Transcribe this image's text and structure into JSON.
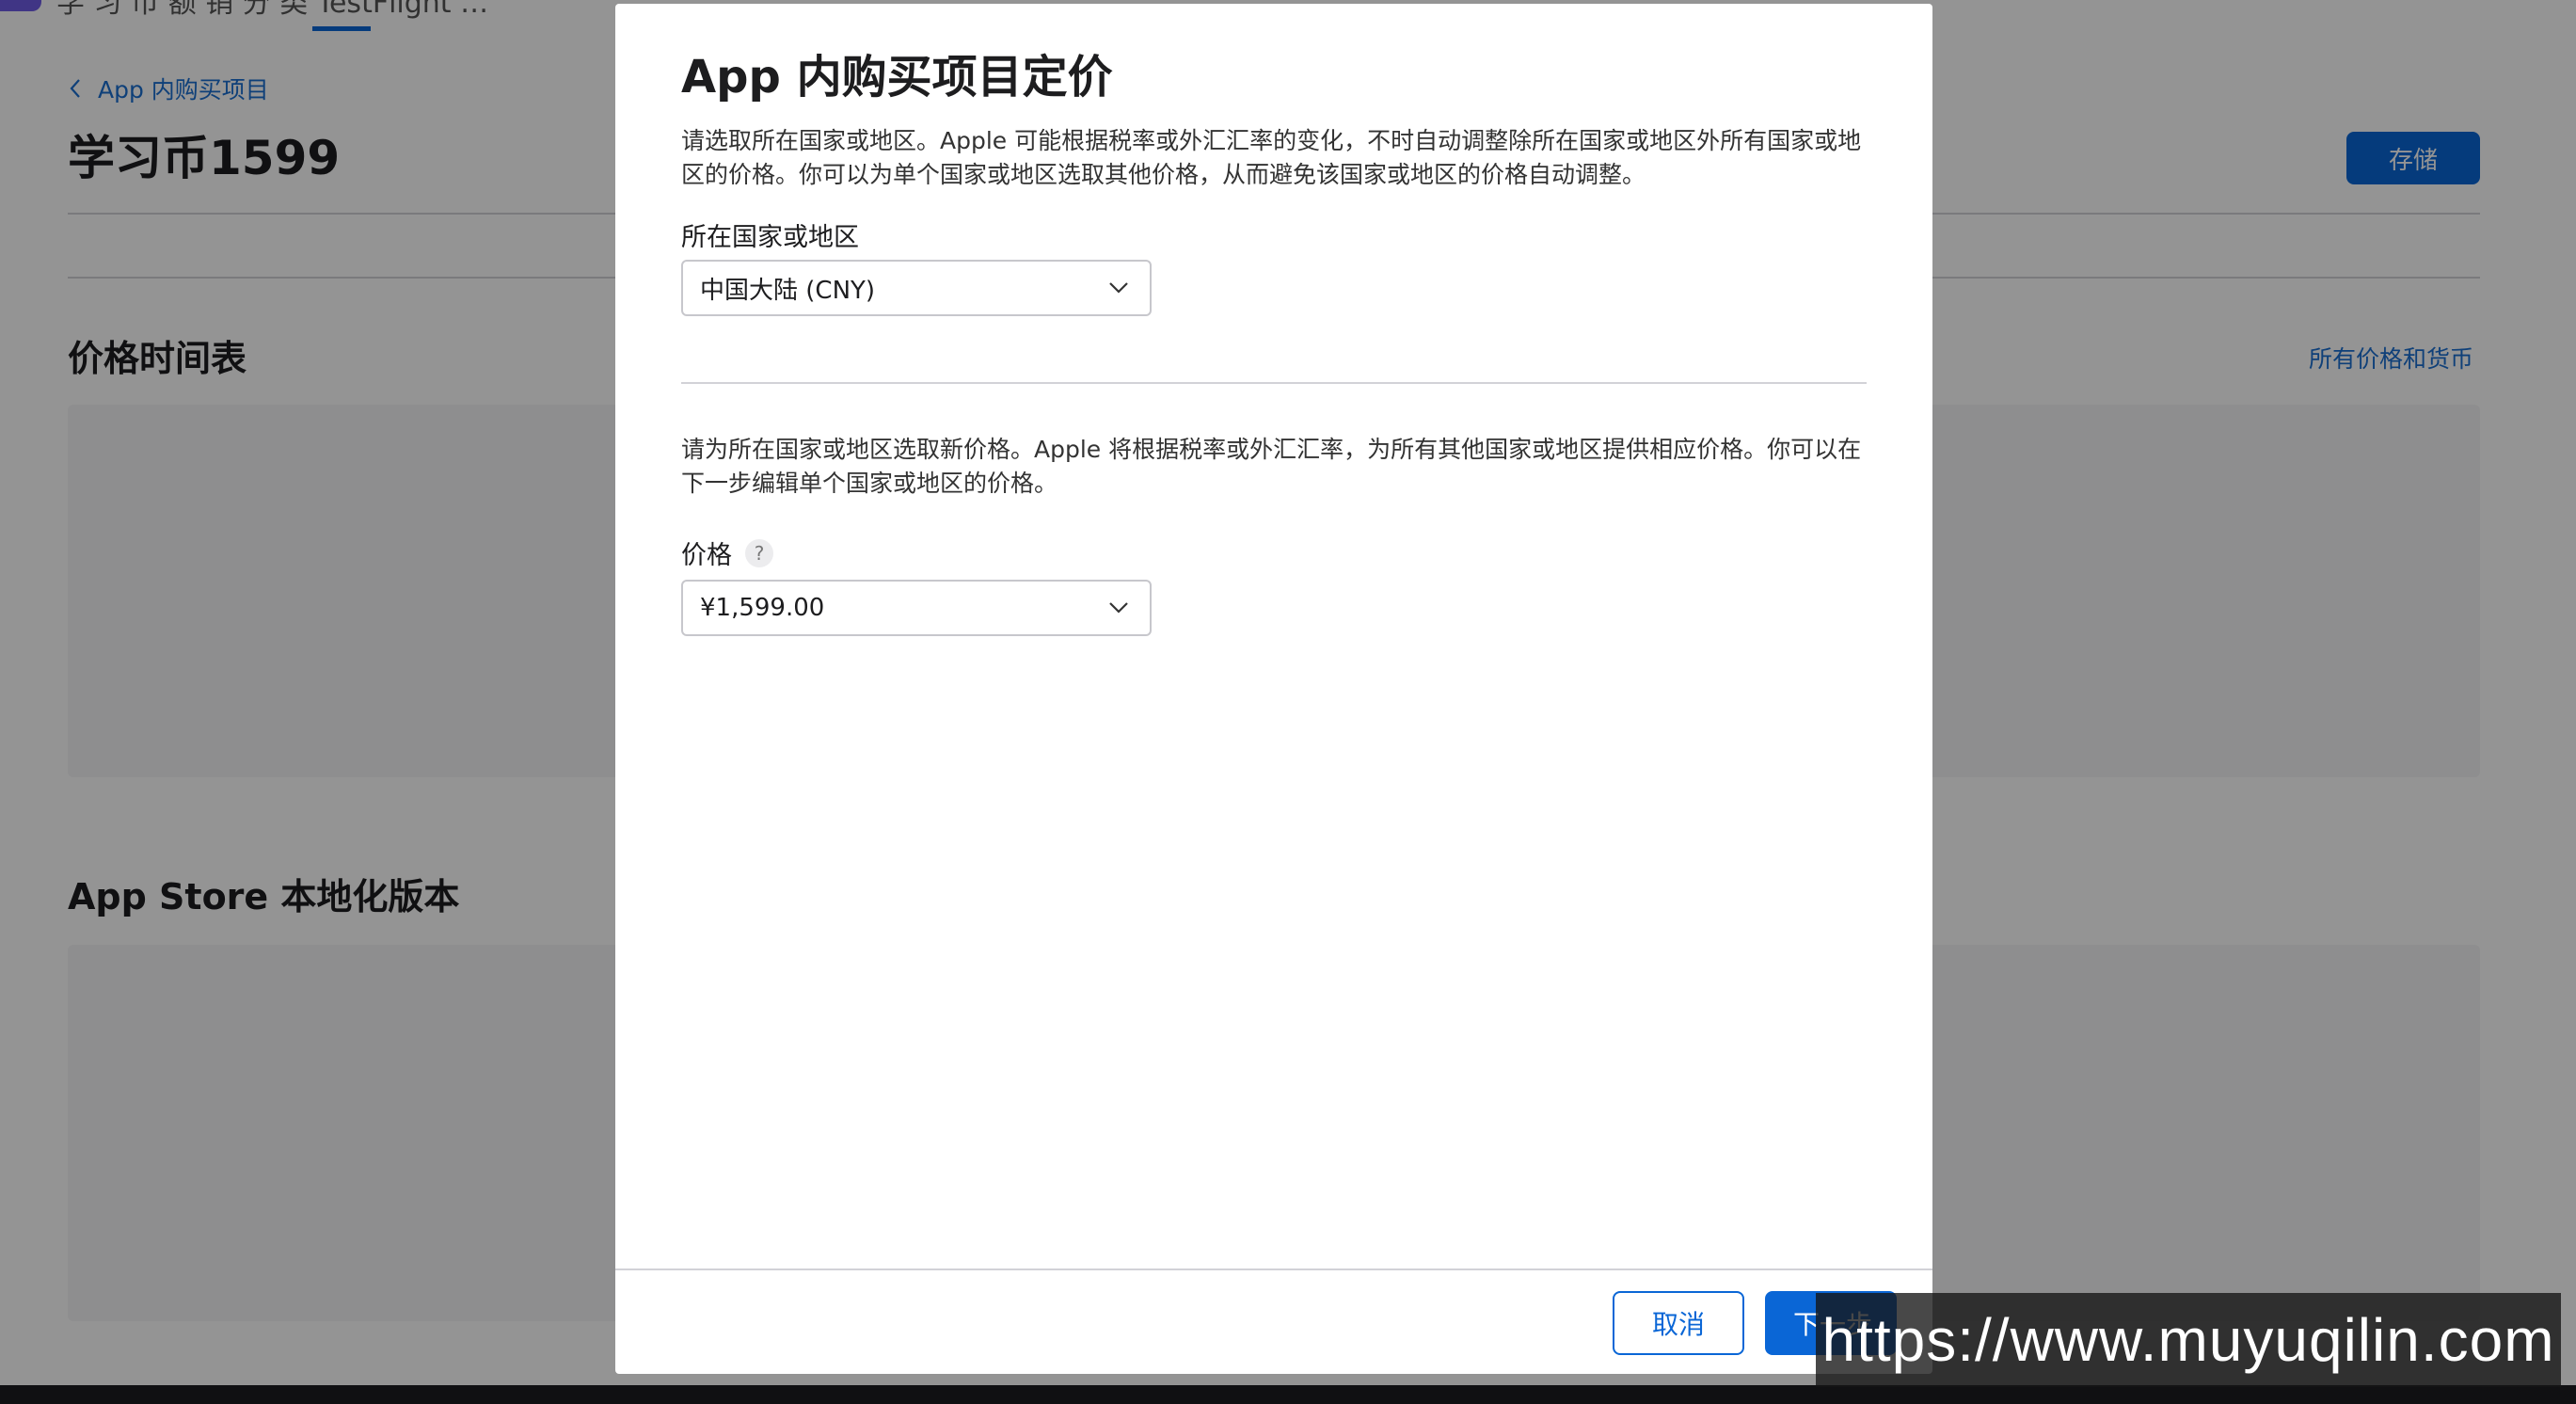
{
  "background": {
    "top_tabs_text": "学 习 币  额 销    分 类    TestFlight    …",
    "breadcrumb_label": "App 内购买项目",
    "page_title": "学习币1599",
    "save_label": "存储",
    "section_price_schedule": "价格时间表",
    "all_prices_link": "所有价格和货币",
    "section_localization": "App Store 本地化版本"
  },
  "modal": {
    "title": "App 内购买项目定价",
    "region_description": "请选取所在国家或地区。Apple 可能根据税率或外汇汇率的变化，不时自动调整除所在国家或地区外所有国家或地区的价格。你可以为单个国家或地区选取其他价格，从而避免该国家或地区的价格自动调整。",
    "region_label": "所在国家或地区",
    "region_value": "中国大陆 (CNY)",
    "price_description": "请为所在国家或地区选取新价格。Apple 将根据税率或外汇汇率，为所有其他国家或地区提供相应价格。你可以在下一步编辑单个国家或地区的价格。",
    "price_label": "价格",
    "help_symbol": "?",
    "price_value": "¥1,599.00",
    "cancel_label": "取消",
    "next_label": "下一步"
  },
  "watermark": {
    "text": "https://www.muyuqilin.com"
  },
  "colors": {
    "accent": "#0a66d6",
    "overlay": "rgba(0,0,0,0.42)"
  }
}
